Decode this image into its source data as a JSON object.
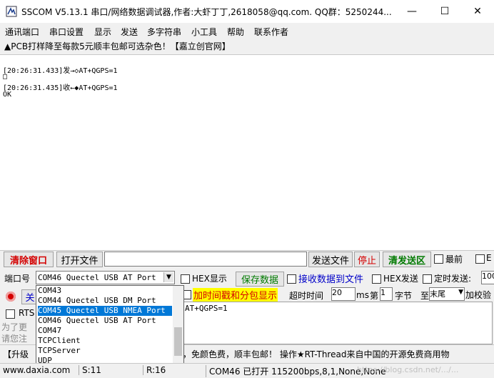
{
  "window": {
    "title": "SSCOM V5.13.1 串口/网络数据调试器,作者:大虾丁丁,2618058@qq.com. QQ群：5250244...",
    "minimize": "—",
    "maximize": "☐",
    "close": "✕"
  },
  "menu": [
    "通讯端口",
    "串口设置",
    "显示",
    "发送",
    "多字符串",
    "小工具",
    "帮助",
    "联系作者"
  ],
  "promo": "▲PCB打样降至每款5元顺丰包邮可选杂色！【嘉立创官网】",
  "log": [
    "[20:26:31.433]发→◇AT+QGPS=1",
    "□",
    "[20:26:31.435]收←◆AT+QGPS=1",
    "OK"
  ],
  "toolbar": {
    "clear_window": "清除窗口",
    "open_file": "打开文件",
    "send_file": "发送文件",
    "stop": "停止",
    "clear_send": "清发送区",
    "front": "最前",
    "e_label": "E"
  },
  "port": {
    "label": "端口号",
    "selected": "COM46 Quectel USB AT Port",
    "hex_display": "HEX显示",
    "save_data": "保存数据",
    "recv_to_file": "接收数据到文件",
    "hex_send": "HEX发送",
    "timed_send": "定时发送:",
    "timed_value": "100",
    "options": [
      "COM43",
      "COM44 Quectel USB DM Port",
      "COM45 Quectel USB NMEA Port",
      "COM46 Quectel USB AT Port",
      "COM47",
      "TCPClient",
      "TCPServer",
      "UDP"
    ],
    "selected_option": "COM45 Quectel USB NMEA Port"
  },
  "row3": {
    "close_btn": "关",
    "timestamp": "加时间戳和分包显示",
    "timeout_label": "超时时间",
    "timeout_value": "20",
    "ms": "ms",
    "di": "第",
    "byte_value": "1",
    "byte_label": "字节",
    "to": "至",
    "end_sel": "末尾",
    "checksum": "加校验"
  },
  "row4": {
    "rts": "RTS",
    "send_text": "AT+QGPS=1"
  },
  "left_notes": [
    "为了更",
    "请您注"
  ],
  "ticker": "【升级",
  "ticker_rest": "，免颜色费，顺丰包邮！ 操作★RT-Thread来自中国的开源免费商用物",
  "status": {
    "website": "www.daxia.com",
    "s_count": "S:11",
    "r_count": "R:16",
    "port_status": "COM46 已打开  115200bps,8,1,None,None"
  },
  "watermark": "https://blog.csdn.net/.../...",
  "colors": {
    "red_text": "#d40000",
    "green_text": "#007a00",
    "blue_text": "#0000c8",
    "select_blue": "#0078d7",
    "yellow_hl": "#ffff00"
  }
}
